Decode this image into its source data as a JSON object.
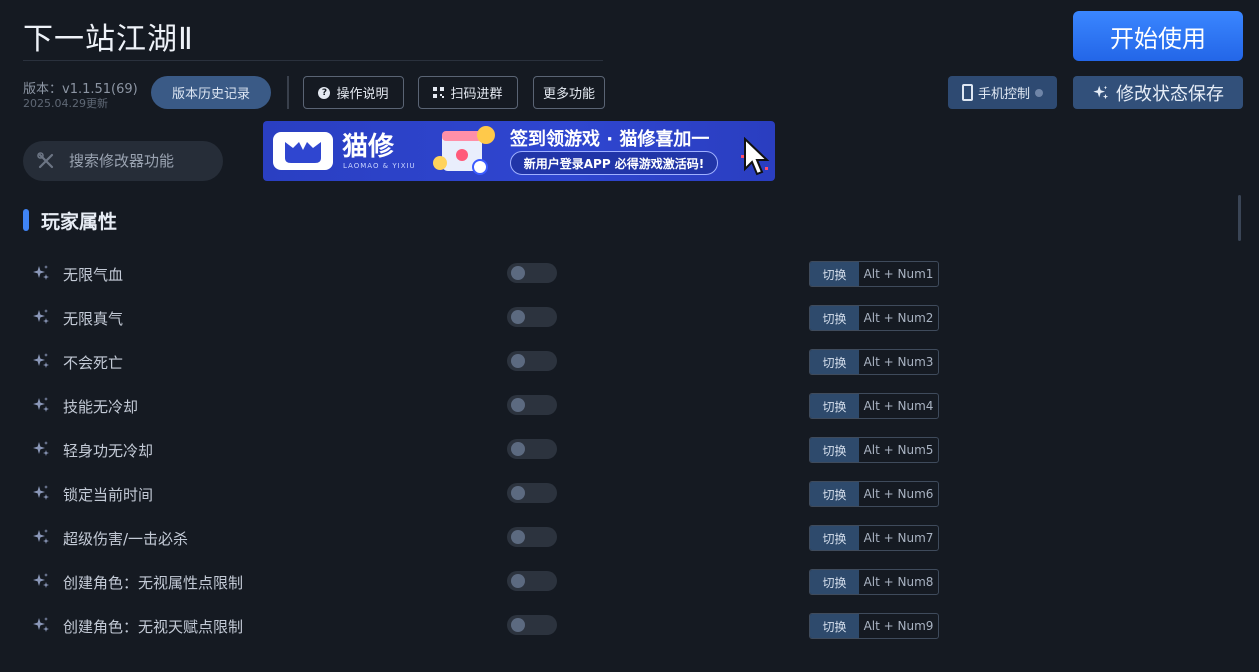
{
  "header": {
    "title": "下一站江湖Ⅱ",
    "start_label": "开始使用",
    "version_label": "版本：v1.1.51(69)",
    "version_date": "2025.04.29更新",
    "history_label": "版本历史记录",
    "help_label": "操作说明",
    "qr_label": "扫码进群",
    "more_label": "更多功能",
    "phone_label": "手机控制",
    "save_label": "修改状态保存"
  },
  "search": {
    "placeholder": "搜索修改器功能"
  },
  "banner": {
    "brand": "猫修",
    "brand_sub": "LAOMAO & YIXIU",
    "headline": "签到领游戏 · 猫修喜加一",
    "pill": "新用户登录APP  必得游戏激活码!"
  },
  "section": {
    "title": "玩家属性"
  },
  "hotkey_action": "切换",
  "features": [
    {
      "label": "无限气血",
      "keys": "Alt + Num1"
    },
    {
      "label": "无限真气",
      "keys": "Alt + Num2"
    },
    {
      "label": "不会死亡",
      "keys": "Alt + Num3"
    },
    {
      "label": "技能无冷却",
      "keys": "Alt + Num4"
    },
    {
      "label": "轻身功无冷却",
      "keys": "Alt + Num5"
    },
    {
      "label": "锁定当前时间",
      "keys": "Alt + Num6"
    },
    {
      "label": "超级伤害/一击必杀",
      "keys": "Alt + Num7"
    },
    {
      "label": "创建角色：无视属性点限制",
      "keys": "Alt + Num8"
    },
    {
      "label": "创建角色：无视天赋点限制",
      "keys": "Alt + Num9"
    }
  ],
  "colors": {
    "background": "#151a22",
    "accent": "#3f84f6",
    "primary_button": "#2a72f5"
  }
}
